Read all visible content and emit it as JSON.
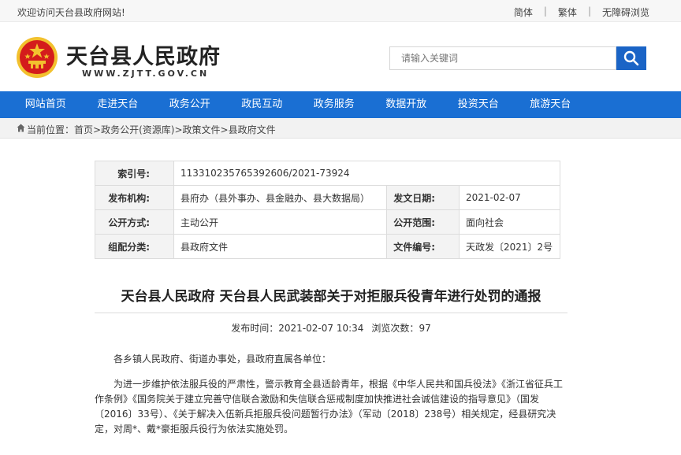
{
  "topbar": {
    "welcome": "欢迎访问天台县政府网站!",
    "links": [
      "简体",
      "繁体",
      "无障碍浏览"
    ]
  },
  "header": {
    "site_title": "天台县人民政府",
    "site_url": "WWW.ZJTT.GOV.CN",
    "search_placeholder": "请输入关键词",
    "emblem_icon": "national-emblem-icon",
    "search_icon": "magnifier-icon"
  },
  "nav": [
    "网站首页",
    "走进天台",
    "政务公开",
    "政民互动",
    "政务服务",
    "数据开放",
    "投资天台",
    "旅游天台"
  ],
  "breadcrumb": {
    "prefix": "当前位置：",
    "items": [
      "首页",
      "政务公开(资源库)",
      "政策文件",
      "县政府文件"
    ],
    "separator": ">"
  },
  "meta": {
    "index_label": "索引号:",
    "index_value": "113310235765392606/2021-73924",
    "org_label": "发布机构:",
    "org_value": "县府办（县外事办、县金融办、县大数据局）",
    "date_label": "发文日期:",
    "date_value": "2021-02-07",
    "method_label": "公开方式:",
    "method_value": "主动公开",
    "scope_label": "公开范围:",
    "scope_value": "面向社会",
    "category_label": "组配分类:",
    "category_value": "县政府文件",
    "docno_label": "文件编号:",
    "docno_value": "天政发〔2021〕2号"
  },
  "article": {
    "title": "天台县人民政府 天台县人民武装部关于对拒服兵役青年进行处罚的通报",
    "publish_label": "发布时间：",
    "publish_time": "2021-02-07 10:34",
    "views_label": "浏览次数：",
    "views": "97",
    "salutation": "各乡镇人民政府、街道办事处，县政府直属各单位：",
    "body": "为进一步维护依法服兵役的严肃性，警示教育全县适龄青年，根据《中华人民共和国兵役法》《浙江省征兵工作条例》《国务院关于建立完善守信联合激励和失信联合惩戒制度加快推进社会诚信建设的指导意见》（国发〔2016〕33号）、《关于解决入伍新兵拒服兵役问题暂行办法》（军动〔2018〕238号）相关规定，经县研究决定，对周*、戴*豪拒服兵役行为依法实施处罚。"
  },
  "colors": {
    "nav_bg": "#1a6fd3",
    "search_btn": "#1a64c6",
    "emblem_red": "#d41c1c",
    "emblem_gold": "#f2c12e"
  }
}
